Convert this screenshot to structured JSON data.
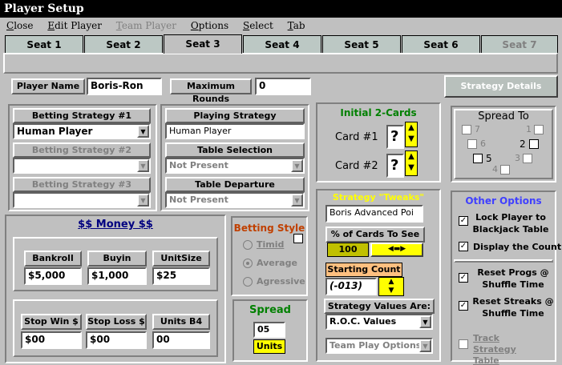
{
  "window": {
    "title": "Player Setup"
  },
  "menu": {
    "close": "Close",
    "edit_player": "Edit Player",
    "team_player": "Team Player",
    "options": "Options",
    "select": "Select",
    "tab": "Tab"
  },
  "tabs": [
    "Seat 1",
    "Seat 2",
    "Seat 3",
    "Seat 4",
    "Seat 5",
    "Seat 6",
    "Seat 7"
  ],
  "player": {
    "name_label": "Player Name",
    "name_value": "Boris-Ron",
    "max_rounds_label": "Maximum Rounds",
    "max_rounds_value": "0",
    "strategy_details": "Strategy Details"
  },
  "betting": {
    "s1_label": "Betting Strategy #1",
    "s1_value": "Human Player",
    "s2_label": "Betting Strategy #2",
    "s2_value": "",
    "s3_label": "Betting Strategy #3",
    "s3_value": ""
  },
  "playing": {
    "label": "Playing Strategy",
    "value": "Human Player",
    "table_sel_label": "Table Selection",
    "table_sel_value": "Not Present",
    "table_dep_label": "Table Departure",
    "table_dep_value": "Not Present"
  },
  "initial": {
    "title": "Initial 2-Cards",
    "card1_label": "Card #1",
    "card1_value": "?",
    "card2_label": "Card #2",
    "card2_value": "?"
  },
  "spread_to": {
    "title": "Spread To",
    "numbers": [
      "7",
      "1",
      "6",
      "2",
      "5",
      "3",
      "4"
    ]
  },
  "money": {
    "title": "$$ Money $$",
    "bankroll_label": "Bankroll",
    "bankroll_value": "$5,000",
    "buyin_label": "Buyin",
    "buyin_value": "$1,000",
    "unitsize_label": "UnitSize",
    "unitsize_value": "$25",
    "stopwin_label": "Stop Win $",
    "stopwin_value": "$00",
    "stoploss_label": "Stop Loss $",
    "stoploss_value": "$00",
    "unitsb4_label": "Units B4",
    "unitsb4_value": "00"
  },
  "betting_style": {
    "title": "Betting Style",
    "timid": "Timid",
    "average": "Average",
    "agressive": "Agressive"
  },
  "spread": {
    "title": "Spread",
    "value": "05",
    "units": "Units"
  },
  "tweaks": {
    "title": "Strategy \"Tweaks\"",
    "value": "Boris Advanced Poi",
    "pct_label": "% of Cards To See",
    "pct_value": "100",
    "start_label": "Starting Count",
    "start_value": "(-013)",
    "values_label": "Strategy Values Are:",
    "values_value": "R.O.C. Values",
    "team_value": "Team Play Options"
  },
  "other": {
    "title": "Other Options",
    "lock": "Lock Player to Blackjack Table",
    "display": "Display the Count",
    "reset_progs": "Reset Progs @ Shuffle Time",
    "reset_streaks": "Reset Streaks @ Shuffle Time",
    "track": "Track Strategy Table"
  },
  "colors": {
    "accent_yellow": "#ffff00",
    "title_green": "#008000",
    "style_red": "#c04000",
    "money_blue": "#000080",
    "other_blue": "#4040ff",
    "tweak_orange": "#ffc080"
  }
}
